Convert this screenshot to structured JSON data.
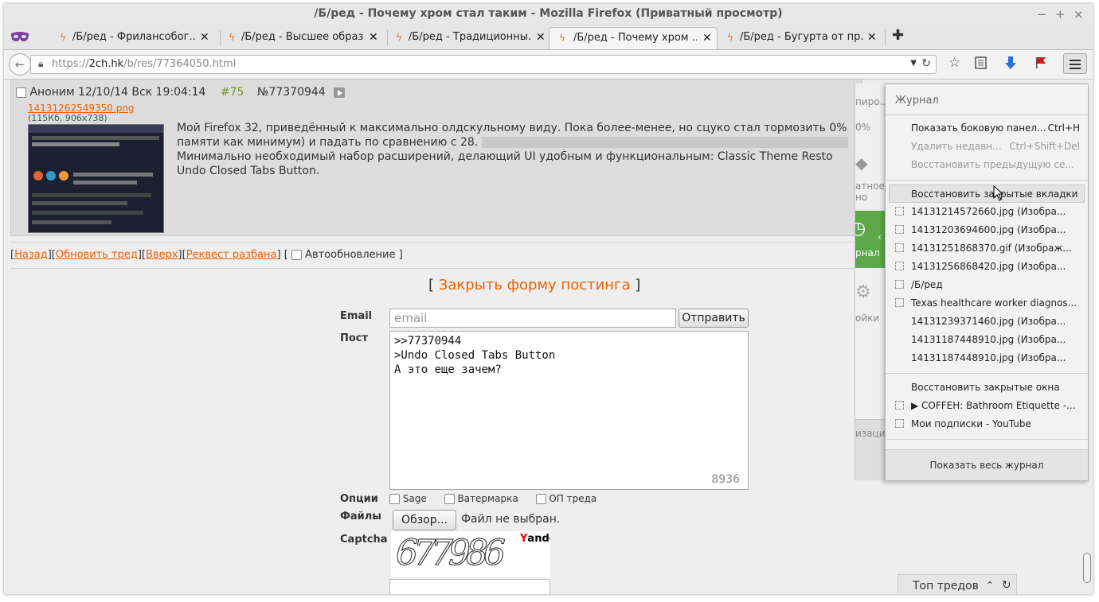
{
  "window": {
    "title": "/Б/ред - Почему хром стал таким - Mozilla Firefox (Приватный просмотр)",
    "controls": [
      "−",
      "+",
      "×"
    ]
  },
  "tabs": [
    {
      "label": "/Б/ред - Фрилансобог...",
      "active": false
    },
    {
      "label": "/Б/ред - Высшее образ...",
      "active": false
    },
    {
      "label": "/Б/ред - Традиционны...",
      "active": false
    },
    {
      "label": "/Б/ред - Почему хром ...",
      "active": true
    },
    {
      "label": "/Б/ред - Бугурта от пр...",
      "active": false
    }
  ],
  "navbar": {
    "url_prefix": "https://",
    "url_host": "2ch.hk",
    "url_path": "/b/res/77364050.html"
  },
  "post": {
    "author": "Аноним",
    "date": "12/10/14 Вск 19:04:14",
    "number": "#75",
    "id": "№77370944",
    "file_name": "14131262549350.png",
    "file_info": "(115Кб, 906x738)",
    "line1": "Мой Firefox 32, приведённый к максимально олдскульному виду. Пока более-менее, но сцуко стал тормозить",
    "line1_tail": "0%",
    "line2": "памяти как минимум) и падать по сравнению с 28.",
    "line3": "Минимально необходимый набор расширений, делающий UI удобным и функциональным: Classic Theme Resto",
    "line4": "Undo Closed Tabs Button."
  },
  "thread_nav": {
    "back": "Назад",
    "refresh": "Обновить тред",
    "top": "Вверх",
    "request": "Реквест разбана",
    "autorefresh": "Автообновление"
  },
  "form": {
    "close_label": "Закрыть форму постинга",
    "email_label": "Email",
    "email_placeholder": "email",
    "submit_label": "Отправить",
    "post_label": "Пост",
    "post_lines": [
      ">>77370944",
      ">Undo Closed Tabs Button",
      "А это еще зачем?"
    ],
    "char_counter": "8936",
    "options_label": "Опции",
    "options": [
      "Sage",
      "Ватермарка",
      "ОП треда"
    ],
    "files_label": "Файлы",
    "browse_label": "Обзор...",
    "no_file": "Файл не выбран.",
    "captcha_label": "Captcha",
    "captcha_digits": "677986",
    "captcha_brand_first": "Y",
    "captcha_brand_rest": "andex"
  },
  "top_threads": {
    "label": "Топ тредов"
  },
  "bg_panel": {
    "t1": "пиро...",
    "t2": "0%",
    "t3": "атное",
    "t4": "но",
    "t5": "рнал",
    "t6": "ойки",
    "t7": "изаци"
  },
  "history": {
    "header": "Журнал",
    "actions": [
      {
        "label": "Показать боковую панел...",
        "shortcut": "Ctrl+H",
        "disabled": false
      },
      {
        "label": "Удалить недавн...",
        "shortcut": "Ctrl+Shift+Del",
        "disabled": true
      },
      {
        "label": "Восстановить предыдущую се...",
        "shortcut": "",
        "disabled": true
      }
    ],
    "closed_tabs_label": "Восстановить закрытые вкладки",
    "closed_tabs": [
      {
        "label": "14131214572660.jpg (Изобра...",
        "icon": true
      },
      {
        "label": "14131203694600.jpg (Изобра...",
        "icon": true
      },
      {
        "label": "14131251868370.gif (Изображ...",
        "icon": true
      },
      {
        "label": "14131256868420.jpg (Изобра...",
        "icon": true
      },
      {
        "label": "/Б/ред",
        "icon": true
      },
      {
        "label": "Texas healthcare worker diagnos...",
        "icon": true
      },
      {
        "label": "14131239371460.jpg (Изобра...",
        "icon": false
      },
      {
        "label": "14131187448910.jpg (Изобра...",
        "icon": false
      },
      {
        "label": "14131187448910.jpg (Изобра...",
        "icon": false
      }
    ],
    "closed_windows_label": "Восстановить закрытые окна",
    "closed_windows": [
      {
        "label": "▶ COFFEH: Bathroom Etiquette -...",
        "icon": true
      },
      {
        "label": "Мои подписки - YouTube",
        "icon": true
      }
    ],
    "footer": "Показать весь журнал"
  },
  "colors": {
    "link": "#f06000",
    "post_number": "#789922",
    "tab_icon": "#f07010",
    "panel_green": "#5da84a"
  }
}
